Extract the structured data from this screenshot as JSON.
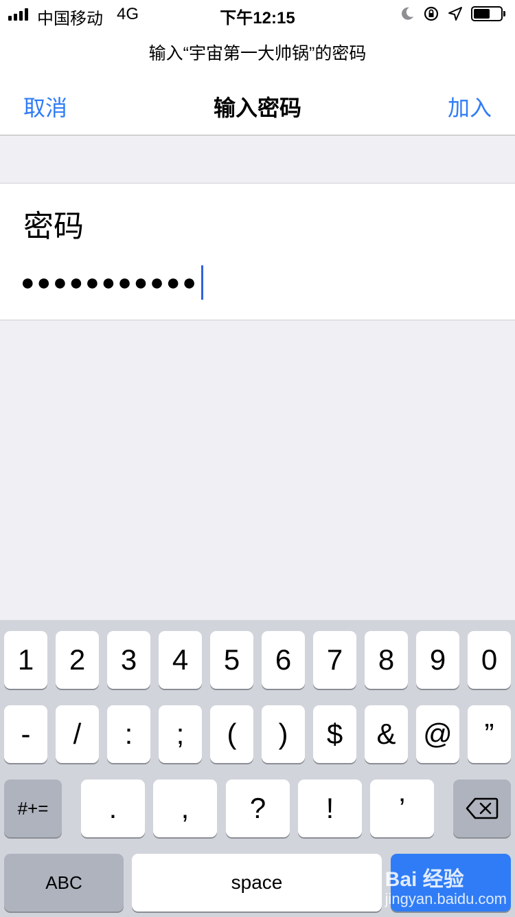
{
  "status_bar": {
    "carrier": "中国移动",
    "network": "4G",
    "time": "下午12:15",
    "icons": [
      "moon-icon",
      "rotation-lock-icon",
      "location-arrow-icon",
      "battery-icon"
    ]
  },
  "prompt": "输入“宇宙第一大帅锅”的密码",
  "nav": {
    "cancel_label": "取消",
    "title": "输入密码",
    "join_label": "加入"
  },
  "password": {
    "label": "密码",
    "masked_value": "●●●●●●●●●●●"
  },
  "keyboard": {
    "row1": [
      "1",
      "2",
      "3",
      "4",
      "5",
      "6",
      "7",
      "8",
      "9",
      "0"
    ],
    "row2": [
      "-",
      "/",
      ":",
      ";",
      "(",
      ")",
      "$",
      "&",
      "@",
      "”"
    ],
    "row3_shift": "#+=",
    "row3": [
      ".",
      ",",
      "?",
      "!",
      "’"
    ],
    "abc_label": "ABC",
    "space_label": "space",
    "delete_icon": "backspace-icon"
  },
  "watermark": {
    "logo": "Bai 经验",
    "url": "jingyan.baidu.com"
  },
  "colors": {
    "accent": "#2f7cf6",
    "background": "#efeff4",
    "keyboard": "#d1d4db",
    "caret": "#2f63d8"
  }
}
